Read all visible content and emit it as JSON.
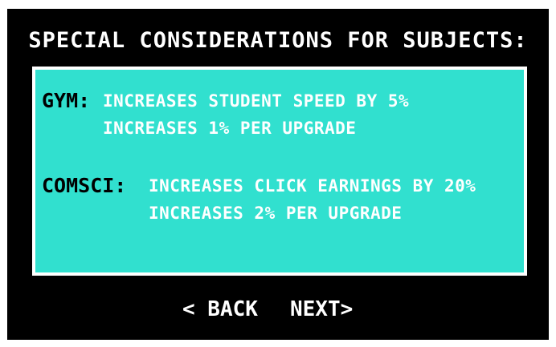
{
  "title": "SPECIAL CONSIDERATIONS FOR SUBJECTS:",
  "subjects": [
    {
      "name": "GYM:",
      "effects": [
        "INCREASES STUDENT SPEED BY 5%",
        "INCREASES 1% PER UPGRADE"
      ]
    },
    {
      "name": "COMSCI:",
      "effects": [
        "INCREASES CLICK EARNINGS BY 20%",
        "INCREASES 2% PER UPGRADE"
      ]
    }
  ],
  "nav": {
    "back_label": "< BACK",
    "next_label": "NEXT>"
  },
  "colors": {
    "background": "#000000",
    "panel": "#31e0cf",
    "panel_border": "#ffffff",
    "text": "#ffffff",
    "subject_name": "#000000"
  }
}
